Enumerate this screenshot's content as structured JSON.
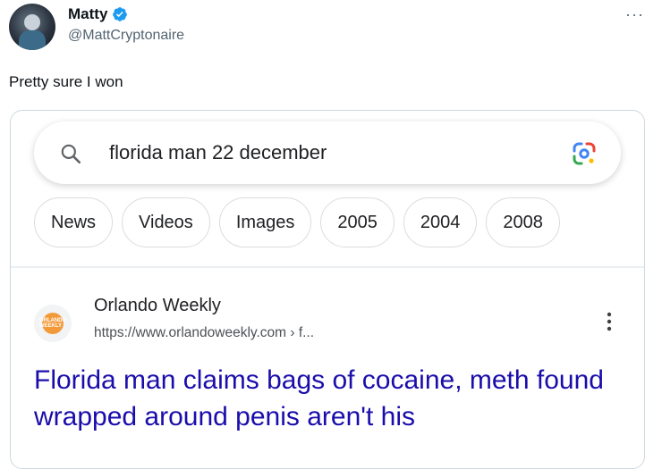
{
  "tweet": {
    "author_name": "Matty",
    "handle": "@MattCryptonaire",
    "text": "Pretty sure I won",
    "more_label": "···"
  },
  "search": {
    "query": "florida man 22 december",
    "chips": [
      "News",
      "Videos",
      "Images",
      "2005",
      "2004",
      "2008"
    ]
  },
  "result": {
    "site_name": "Orlando Weekly",
    "url": "https://www.orlandoweekly.com › f...",
    "favicon_text": "ORLANDO WEEKLY",
    "title": "Florida man claims bags of cocaine, meth found wrapped around penis aren't his"
  },
  "colors": {
    "link": "#1a0dab",
    "verified": "#1d9bf0",
    "favicon": "#f29a3a"
  }
}
